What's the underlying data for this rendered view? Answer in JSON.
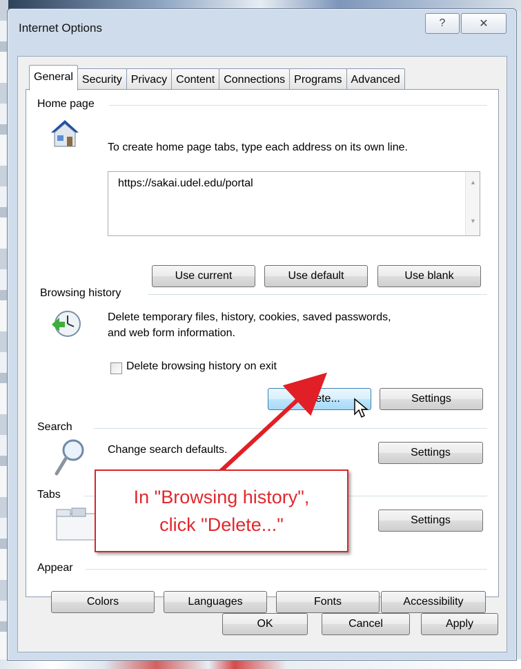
{
  "window": {
    "title": "Internet Options",
    "help_icon": "?",
    "close_icon": "✕"
  },
  "tabs": [
    {
      "label": "General",
      "active": true
    },
    {
      "label": "Security"
    },
    {
      "label": "Privacy"
    },
    {
      "label": "Content"
    },
    {
      "label": "Connections"
    },
    {
      "label": "Programs"
    },
    {
      "label": "Advanced"
    }
  ],
  "home_page": {
    "label": "Home page",
    "description": "To create home page tabs, type each address on its own line.",
    "value": "https://sakai.udel.edu/portal",
    "buttons": [
      "Use current",
      "Use default",
      "Use blank"
    ]
  },
  "browsing_history": {
    "label": "Browsing history",
    "description_line1": "Delete temporary files, history, cookies, saved passwords,",
    "description_line2": "and web form information.",
    "checkbox_label": "Delete browsing history on exit",
    "checkbox_checked": false,
    "delete_button": "Delete...",
    "settings_button": "Settings"
  },
  "search": {
    "label": "Search",
    "description": "Change search defaults.",
    "settings_button": "Settings"
  },
  "tabs_section": {
    "label": "Tabs",
    "settings_button": "Settings"
  },
  "appearance": {
    "label_visible": "Appear",
    "buttons": [
      "Colors",
      "Languages",
      "Fonts",
      "Accessibility"
    ]
  },
  "footer": {
    "ok": "OK",
    "cancel": "Cancel",
    "apply": "Apply"
  },
  "annotation": {
    "line1": "In \"Browsing history\",",
    "line2": "click \"Delete...\"",
    "color": "#e0282e"
  }
}
